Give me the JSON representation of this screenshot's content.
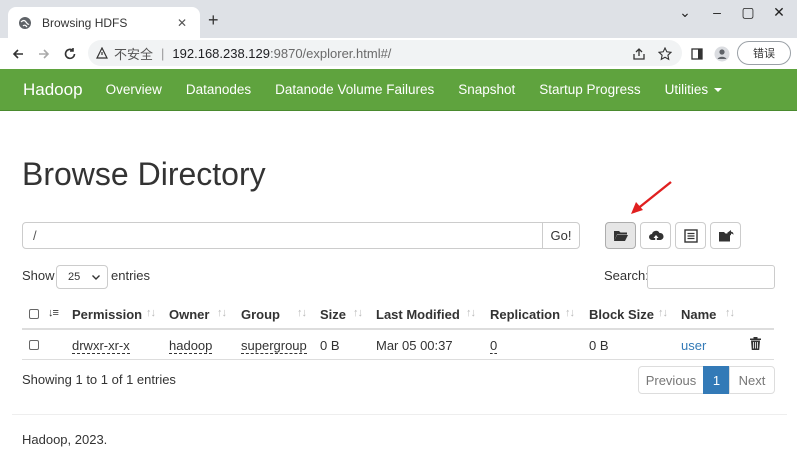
{
  "browser": {
    "tab_title": "Browsing HDFS",
    "url_insecure_label": "不安全",
    "url_separator": "|",
    "url_host": "192.168.238.129",
    "url_rest": ":9870/explorer.html#/",
    "error_button": "错误"
  },
  "navbar": {
    "brand": "Hadoop",
    "items": [
      "Overview",
      "Datanodes",
      "Datanode Volume Failures",
      "Snapshot",
      "Startup Progress",
      "Utilities"
    ],
    "bg_color": "#5fa33e"
  },
  "page": {
    "title": "Browse Directory",
    "path_value": "/",
    "go_label": "Go!"
  },
  "table_controls": {
    "show_label": "Show",
    "page_length": "25",
    "entries_label": "entries",
    "search_label": "Search:"
  },
  "table": {
    "columns": [
      "Permission",
      "Owner",
      "Group",
      "Size",
      "Last Modified",
      "Replication",
      "Block Size",
      "Name"
    ],
    "rows": [
      {
        "permission": "drwxr-xr-x",
        "owner": "hadoop",
        "group": "supergroup",
        "size": "0 B",
        "last_modified": "Mar 05 00:37",
        "replication": "0",
        "block_size": "0 B",
        "name": "user"
      }
    ]
  },
  "pagination": {
    "info": "Showing 1 to 1 of 1 entries",
    "previous": "Previous",
    "current": "1",
    "next": "Next"
  },
  "footer": "Hadoop, 2023."
}
